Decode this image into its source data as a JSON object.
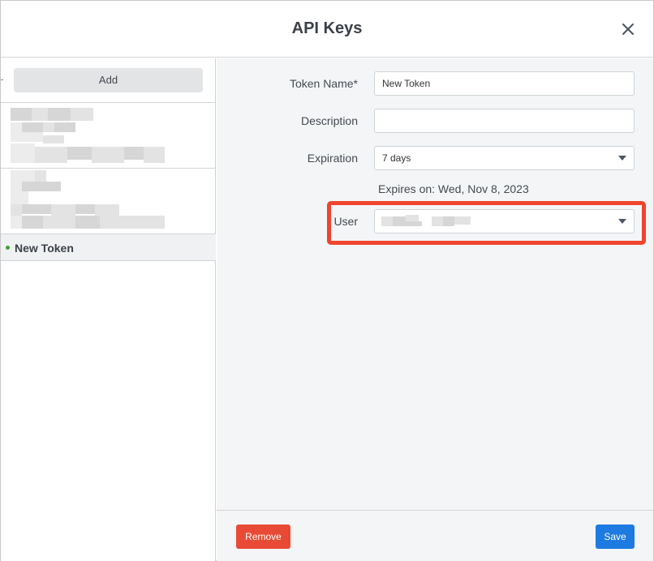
{
  "dialog": {
    "title": "API Keys",
    "close_icon": "close-icon"
  },
  "sidebar": {
    "add_label": "Add",
    "selected_item": {
      "label": "New Token",
      "status_color": "#3aa335"
    }
  },
  "form": {
    "token_name": {
      "label": "Token Name*",
      "value": "New Token"
    },
    "description": {
      "label": "Description",
      "value": ""
    },
    "expiration": {
      "label": "Expiration",
      "value": "7 days"
    },
    "expires_text": "Expires on: Wed, Nov 8, 2023",
    "user": {
      "label": "User"
    }
  },
  "footer": {
    "remove_label": "Remove",
    "save_label": "Save"
  },
  "colors": {
    "danger": "#e84a35",
    "primary": "#1d7ae0",
    "highlight": "#f0452d"
  }
}
